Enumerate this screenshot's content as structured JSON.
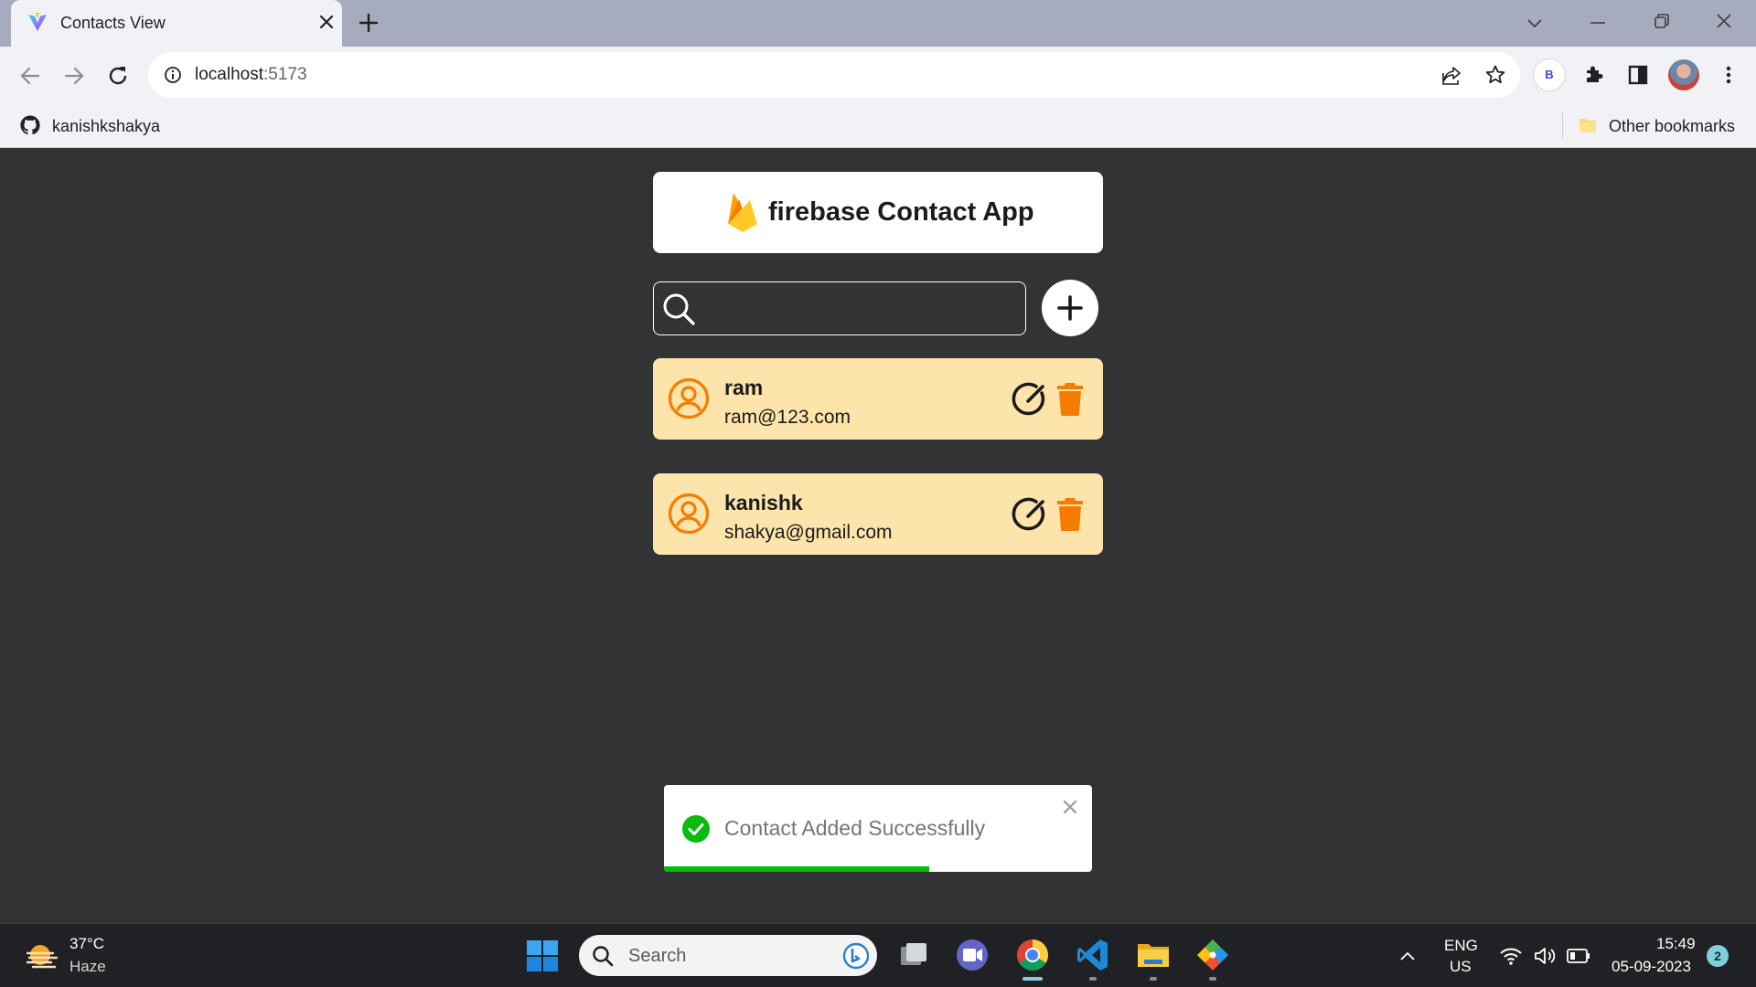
{
  "browser": {
    "tab": {
      "title": "Contacts View",
      "favicon": "vite-logo-icon"
    },
    "address_bar": {
      "host": "localhost",
      "port": ":5173"
    },
    "bookmarks": {
      "github_item": "kanishkshakya",
      "other": "Other bookmarks"
    },
    "profile_initial": "B"
  },
  "app": {
    "title": "firebase Contact App",
    "search": {
      "value": "",
      "placeholder": ""
    },
    "contacts": [
      {
        "name": "ram",
        "email": "ram@123.com"
      },
      {
        "name": "kanishk",
        "email": "shakya@gmail.com"
      }
    ],
    "colors": {
      "card": "#fde4ab",
      "accent": "#f57c00",
      "background": "#323334"
    }
  },
  "toast": {
    "message": "Contact Added Successfully",
    "status": "success",
    "progress": 0.62,
    "progress_color": "#07bc0c"
  },
  "taskbar": {
    "weather": {
      "temp": "37°C",
      "desc": "Haze"
    },
    "search_label": "Search",
    "apps": [
      "task-view-icon",
      "teams-meet-icon",
      "chrome-icon",
      "vscode-icon",
      "file-explorer-icon",
      "git-icon"
    ],
    "language": {
      "line1": "ENG",
      "line2": "US"
    },
    "clock": {
      "time": "15:49",
      "date": "05-09-2023"
    },
    "notifications": "2"
  }
}
